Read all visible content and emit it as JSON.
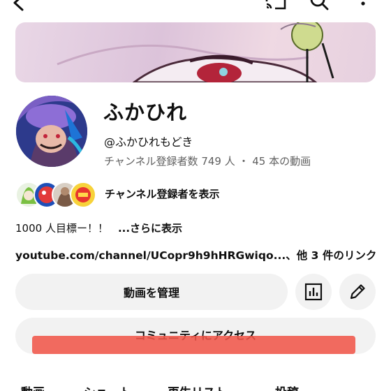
{
  "channel": {
    "name": "ふかひれ",
    "handle": "@ふかひれもどき",
    "stats": "チャンネル登録者数 749 人 ・ 45 本の動画"
  },
  "subscribers": {
    "label": "チャンネル登録者を表示"
  },
  "description": {
    "text": "1000 人目標ー！！",
    "more": "...さらに表示"
  },
  "links": {
    "url": "youtube.com/channel/UCopr9h9hHRGwiqo...",
    "others": "、他 3 件のリンク"
  },
  "buttons": {
    "manage_videos": "動画を管理",
    "community": "コミュニティにアクセス"
  },
  "tabs": [
    "動画",
    "ショート",
    "再生リスト",
    "投稿"
  ],
  "icons": {
    "back": "back-arrow-icon",
    "cast": "cast-icon",
    "search": "search-icon",
    "more": "more-vert-icon",
    "stats": "analytics-icon",
    "edit": "pencil-icon"
  },
  "colors": {
    "button_bg": "#f2f2f2",
    "annotation_red": "#f0564a",
    "secondary_text": "#606060"
  }
}
